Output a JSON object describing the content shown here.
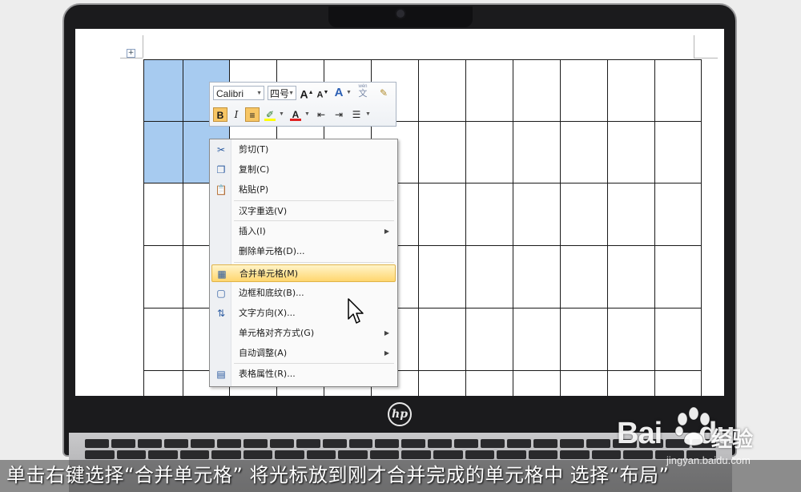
{
  "mini_toolbar": {
    "font_name": "Calibri",
    "font_size": "四号",
    "grow_font": "A",
    "shrink_font": "A",
    "bold": "B",
    "italic": "I",
    "font_color_glyph": "A",
    "phonetic_top": "wén",
    "phonetic_glyph": "文",
    "styles_glyph": "A"
  },
  "context_menu": {
    "items": [
      {
        "label": "剪切(T)",
        "icon": "scissors-icon"
      },
      {
        "label": "复制(C)",
        "icon": "copy-icon"
      },
      {
        "label": "粘贴(P)",
        "icon": "paste-icon"
      },
      {
        "label": "汉字重选(V)",
        "icon": ""
      },
      {
        "label": "插入(I)",
        "icon": "",
        "submenu": true
      },
      {
        "label": "删除单元格(D)...",
        "icon": ""
      },
      {
        "label": "合并单元格(M)",
        "icon": "merge-cells-icon",
        "highlighted": true
      },
      {
        "label": "边框和底纹(B)...",
        "icon": "borders-icon"
      },
      {
        "label": "文字方向(X)...",
        "icon": "text-direction-icon"
      },
      {
        "label": "单元格对齐方式(G)",
        "icon": "",
        "submenu": true
      },
      {
        "label": "自动调整(A)",
        "icon": "",
        "submenu": true
      },
      {
        "label": "表格属性(R)...",
        "icon": "table-properties-icon"
      }
    ]
  },
  "caption": "单击右键选择“合并单元格” 将光标放到刚才合并完成的单元格中 选择“布局”",
  "watermark": {
    "brand": "Bai",
    "brand_suffix": "du",
    "jingyan": "经验",
    "url": "jingyan.baidu.com"
  },
  "laptop": {
    "logo": "hp"
  },
  "colors": {
    "selection": "#a7cbf0",
    "menu_highlight": "#ffd66e",
    "bezel": "#1b1b1d"
  }
}
